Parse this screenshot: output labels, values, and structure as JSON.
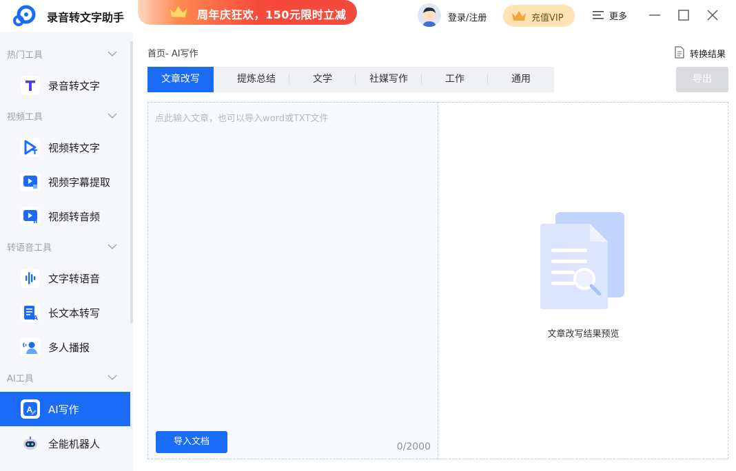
{
  "app": {
    "title": "录音转文字助手"
  },
  "promo": {
    "text": "周年庆狂欢，150元限时立减"
  },
  "header": {
    "login_label": "登录/注册",
    "vip_label": "充值VIP",
    "more_label": "更多"
  },
  "sidebar": {
    "groups": [
      {
        "label": "热门工具",
        "items": [
          {
            "label": "录音转文字",
            "icon": "text-t-icon"
          }
        ]
      },
      {
        "label": "视频工具",
        "items": [
          {
            "label": "视频转文字",
            "icon": "video-play-icon"
          },
          {
            "label": "视频字幕提取",
            "icon": "subtitle-extract-icon"
          },
          {
            "label": "视频转音频",
            "icon": "video-audio-icon"
          }
        ]
      },
      {
        "label": "转语音工具",
        "items": [
          {
            "label": "文字转语音",
            "icon": "waveform-icon"
          },
          {
            "label": "长文本转写",
            "icon": "document-a-icon"
          },
          {
            "label": "多人播报",
            "icon": "broadcast-person-icon"
          }
        ]
      },
      {
        "label": "AI工具",
        "items": [
          {
            "label": "AI写作",
            "icon": "ai-write-icon",
            "active": true
          },
          {
            "label": "全能机器人",
            "icon": "robot-icon"
          }
        ]
      }
    ]
  },
  "main": {
    "breadcrumb": "首页- AI写作",
    "result_link": "转换结果",
    "export_label": "导出",
    "tabs": [
      {
        "label": "文章改写",
        "active": true
      },
      {
        "label": "提炼总结"
      },
      {
        "label": "文学"
      },
      {
        "label": "社媒写作"
      },
      {
        "label": "工作"
      },
      {
        "label": "通用"
      }
    ],
    "editor": {
      "placeholder": "点此输入文章，也可以导入word或TXT文件",
      "value": "",
      "import_label": "导入文档",
      "char_count": "0/2000"
    },
    "preview": {
      "label": "文章改写结果预览"
    }
  },
  "colors": {
    "accent": "#1a6cf6",
    "promo_red": "#f24a3c",
    "vip_gold": "#ffe3b5"
  }
}
